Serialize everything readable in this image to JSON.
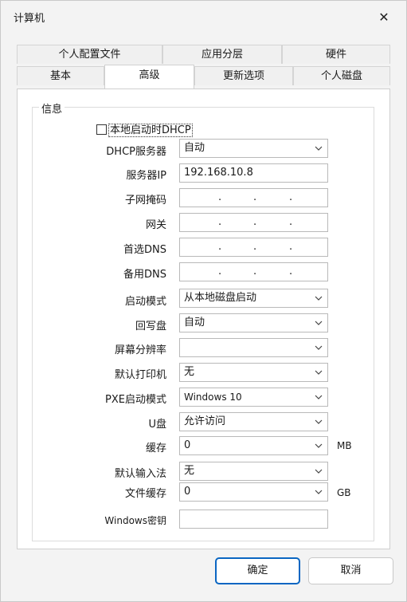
{
  "window": {
    "title": "计算机"
  },
  "tabs_row1": [
    "个人配置文件",
    "应用分层",
    "硬件"
  ],
  "tabs_row2": [
    "基本",
    "高级",
    "更新选项",
    "个人磁盘"
  ],
  "active_tab": "高级",
  "group": {
    "legend": "信息",
    "checkbox_label": "本地启动时DHCP",
    "checkbox_checked": false,
    "fields": {
      "dhcp_server": {
        "label": "DHCP服务器",
        "value": "自动"
      },
      "server_ip": {
        "label": "服务器IP",
        "value": "192.168.10.8"
      },
      "subnet_mask": {
        "label": "子网掩码"
      },
      "gateway": {
        "label": "网关"
      },
      "preferred_dns": {
        "label": "首选DNS"
      },
      "alternate_dns": {
        "label": "备用DNS"
      },
      "boot_mode": {
        "label": "启动模式",
        "value": "从本地磁盘启动"
      },
      "writeback_disk": {
        "label": "回写盘",
        "value": "自动"
      },
      "resolution": {
        "label": "屏幕分辨率",
        "value": ""
      },
      "default_printer": {
        "label": "默认打印机",
        "value": "无"
      },
      "pxe_boot_mode": {
        "label": "PXE启动模式",
        "value": "Windows 10"
      },
      "usb_disk": {
        "label": "U盘",
        "value": "允许访问"
      },
      "cache": {
        "label": "缓存",
        "value": "0",
        "unit": "MB"
      },
      "input_method": {
        "label": "默认输入法",
        "value": "无"
      },
      "file_cache": {
        "label": "文件缓存",
        "value": "0",
        "unit": "GB"
      },
      "windows_key": {
        "label": "Windows密钥",
        "value": ""
      }
    },
    "ip_dot": "."
  },
  "buttons": {
    "ok": "确定",
    "cancel": "取消"
  },
  "icons": {
    "close": "close-icon",
    "dropdown": "chevron-down-icon"
  }
}
